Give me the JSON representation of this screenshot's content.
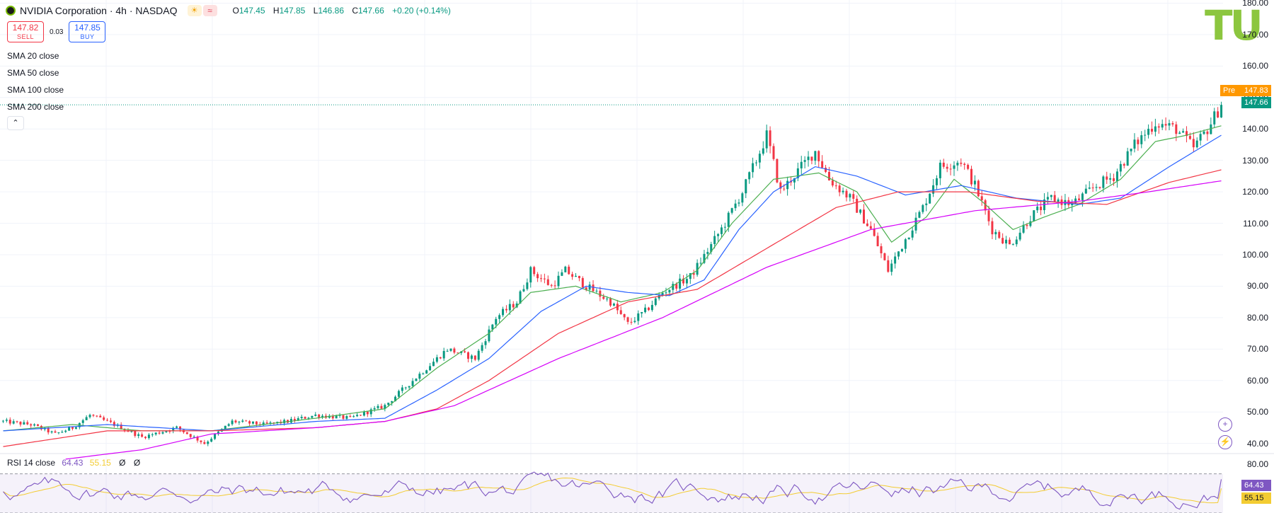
{
  "header": {
    "title": "NVIDIA Corporation · 4h · NASDAQ",
    "badge1": "☀",
    "badge2": "≈",
    "o_key": "O",
    "o_val": "147.45",
    "h_key": "H",
    "h_val": "147.85",
    "l_key": "L",
    "l_val": "146.86",
    "c_key": "C",
    "c_val": "147.66",
    "change": "+0.20 (+0.14%)"
  },
  "trade": {
    "sell_price": "147.82",
    "sell_label": "SELL",
    "spread": "0.03",
    "buy_price": "147.85",
    "buy_label": "BUY"
  },
  "indicators": [
    "SMA 20 close",
    "SMA 50 close",
    "SMA 100 close",
    "SMA 200 close"
  ],
  "collapse_icon": "chevron-up-icon",
  "rsi_legend": {
    "name": "RSI 14 close",
    "rsi": "64.43",
    "ma": "55.15",
    "icon1": "Ø",
    "icon2": "Ø"
  },
  "watermark": "TU",
  "price_labels": {
    "pre_tag": "Pre",
    "pre": "147.83",
    "last": "147.66",
    "rsi": "64.43",
    "rsi_ma": "55.15"
  },
  "colors": {
    "up": "#089981",
    "down": "#f23645",
    "sma20": "#4caf50",
    "sma50": "#2962ff",
    "sma100": "#f23645",
    "sma200": "#d500f9",
    "rsi": "#7e57c2",
    "rsi_ma": "#f3cc32",
    "pre": "#ff9800",
    "last": "#089981"
  },
  "chart_data": {
    "type": "line",
    "title": "NVIDIA Corporation · 4h · NASDAQ",
    "y_axis_ticks": [
      180,
      170,
      160,
      150,
      140,
      130,
      120,
      110,
      100,
      90,
      80,
      70,
      60,
      50,
      40
    ],
    "ylim": [
      37,
      181
    ],
    "candle_path_anchors": [
      [
        0,
        47
      ],
      [
        8,
        46
      ],
      [
        15,
        43
      ],
      [
        20,
        45
      ],
      [
        25,
        49
      ],
      [
        32,
        46
      ],
      [
        40,
        42
      ],
      [
        50,
        45
      ],
      [
        58,
        40
      ],
      [
        66,
        47
      ],
      [
        75,
        46
      ],
      [
        82,
        47
      ],
      [
        90,
        49
      ],
      [
        100,
        48
      ],
      [
        110,
        52
      ],
      [
        118,
        60
      ],
      [
        128,
        70
      ],
      [
        136,
        67
      ],
      [
        142,
        80
      ],
      [
        148,
        85
      ],
      [
        152,
        95
      ],
      [
        158,
        90
      ],
      [
        162,
        95
      ],
      [
        168,
        90
      ],
      [
        175,
        85
      ],
      [
        180,
        78
      ],
      [
        185,
        82
      ],
      [
        190,
        88
      ],
      [
        198,
        93
      ],
      [
        204,
        103
      ],
      [
        208,
        110
      ],
      [
        213,
        120
      ],
      [
        217,
        130
      ],
      [
        220,
        138
      ],
      [
        224,
        120
      ],
      [
        230,
        128
      ],
      [
        234,
        133
      ],
      [
        238,
        124
      ],
      [
        244,
        118
      ],
      [
        250,
        108
      ],
      [
        255,
        95
      ],
      [
        260,
        105
      ],
      [
        265,
        115
      ],
      [
        270,
        128
      ],
      [
        276,
        130
      ],
      [
        280,
        122
      ],
      [
        285,
        108
      ],
      [
        290,
        103
      ],
      [
        296,
        112
      ],
      [
        302,
        118
      ],
      [
        308,
        116
      ],
      [
        315,
        122
      ],
      [
        320,
        125
      ],
      [
        326,
        135
      ],
      [
        332,
        142
      ],
      [
        338,
        140
      ],
      [
        343,
        134
      ],
      [
        347,
        140
      ],
      [
        351,
        147.66
      ]
    ],
    "series": [
      {
        "name": "SMA 20 close",
        "anchors": [
          [
            0,
            44
          ],
          [
            20,
            46
          ],
          [
            40,
            44
          ],
          [
            60,
            44
          ],
          [
            90,
            48
          ],
          [
            110,
            51
          ],
          [
            125,
            64
          ],
          [
            140,
            75
          ],
          [
            152,
            88
          ],
          [
            165,
            90
          ],
          [
            178,
            85
          ],
          [
            190,
            88
          ],
          [
            200,
            95
          ],
          [
            210,
            110
          ],
          [
            222,
            124
          ],
          [
            235,
            126
          ],
          [
            246,
            120
          ],
          [
            256,
            104
          ],
          [
            266,
            112
          ],
          [
            274,
            124
          ],
          [
            282,
            117
          ],
          [
            291,
            108
          ],
          [
            300,
            112
          ],
          [
            310,
            116
          ],
          [
            322,
            124
          ],
          [
            332,
            136
          ],
          [
            341,
            138
          ],
          [
            351,
            141
          ]
        ]
      },
      {
        "name": "SMA 50 close",
        "anchors": [
          [
            0,
            44
          ],
          [
            30,
            46
          ],
          [
            60,
            44
          ],
          [
            90,
            47
          ],
          [
            110,
            48
          ],
          [
            125,
            57
          ],
          [
            140,
            67
          ],
          [
            155,
            82
          ],
          [
            168,
            90
          ],
          [
            180,
            88
          ],
          [
            192,
            87
          ],
          [
            202,
            92
          ],
          [
            212,
            108
          ],
          [
            222,
            120
          ],
          [
            234,
            128
          ],
          [
            246,
            125
          ],
          [
            260,
            119
          ],
          [
            276,
            122
          ],
          [
            292,
            118
          ],
          [
            310,
            116
          ],
          [
            322,
            118
          ],
          [
            336,
            128
          ],
          [
            351,
            138
          ]
        ]
      },
      {
        "name": "SMA 100 close",
        "anchors": [
          [
            0,
            39
          ],
          [
            30,
            44
          ],
          [
            60,
            44
          ],
          [
            90,
            45
          ],
          [
            110,
            47
          ],
          [
            125,
            51
          ],
          [
            140,
            60
          ],
          [
            160,
            75
          ],
          [
            180,
            85
          ],
          [
            200,
            89
          ],
          [
            220,
            102
          ],
          [
            240,
            115
          ],
          [
            258,
            120
          ],
          [
            278,
            120
          ],
          [
            298,
            117
          ],
          [
            318,
            116
          ],
          [
            336,
            123
          ],
          [
            351,
            127
          ]
        ]
      },
      {
        "name": "SMA 200 close",
        "anchors": [
          [
            18,
            35
          ],
          [
            40,
            38
          ],
          [
            60,
            43
          ],
          [
            90,
            45
          ],
          [
            110,
            47
          ],
          [
            130,
            52
          ],
          [
            160,
            67
          ],
          [
            190,
            80
          ],
          [
            220,
            96
          ],
          [
            250,
            108
          ],
          [
            280,
            114
          ],
          [
            310,
            117
          ],
          [
            330,
            120
          ],
          [
            351,
            123.5
          ]
        ]
      }
    ],
    "rsi": {
      "name": "RSI 14 close",
      "ylim": [
        30,
        90
      ],
      "ticks": [
        80
      ],
      "bands": [
        70,
        30
      ],
      "last": 64.43,
      "ma_last": 55.15
    }
  }
}
